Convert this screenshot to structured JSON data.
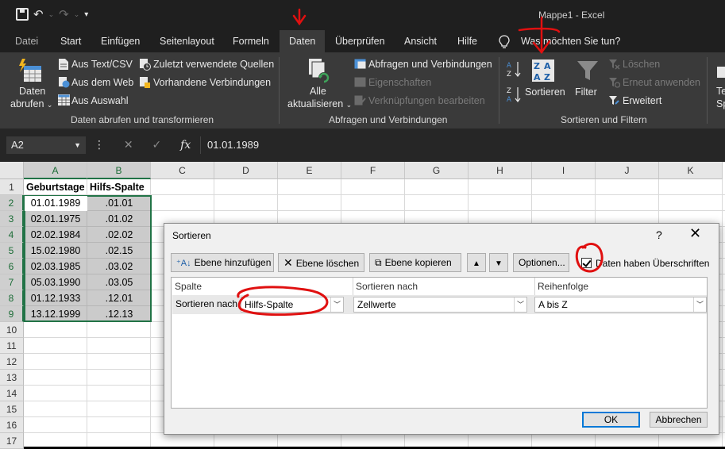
{
  "app": {
    "doc_title": "Mappe1  -  Excel"
  },
  "tabs": [
    {
      "label": "Datei"
    },
    {
      "label": "Start"
    },
    {
      "label": "Einfügen"
    },
    {
      "label": "Seitenlayout"
    },
    {
      "label": "Formeln"
    },
    {
      "label": "Daten"
    },
    {
      "label": "Überprüfen"
    },
    {
      "label": "Ansicht"
    },
    {
      "label": "Hilfe"
    }
  ],
  "tell_me": "Was möchten Sie tun?",
  "ribbon": {
    "get_data": {
      "line1": "Daten",
      "line2": "abrufen"
    },
    "from_text": "Aus Text/CSV",
    "from_web": "Aus dem Web",
    "from_table": "Aus Auswahl",
    "recent_sources": "Zuletzt verwendete Quellen",
    "existing_connections": "Vorhandene Verbindungen",
    "group1": "Daten abrufen und transformieren",
    "refresh_all": {
      "line1": "Alle",
      "line2": "aktualisieren"
    },
    "queries_connections": "Abfragen und Verbindungen",
    "properties": "Eigenschaften",
    "edit_links": "Verknüpfungen bearbeiten",
    "group2": "Abfragen und Verbindungen",
    "sort": "Sortieren",
    "filter": "Filter",
    "clear": "Löschen",
    "reapply": "Erneut anwenden",
    "advanced": "Erweitert",
    "group3": "Sortieren und Filtern",
    "text_to_cols": {
      "line1": "Te",
      "line2": "Sp"
    }
  },
  "formula_bar": {
    "name_box": "A2",
    "value": "01.01.1989"
  },
  "sheet": {
    "columns": [
      "A",
      "B",
      "C",
      "D",
      "E",
      "F",
      "G",
      "H",
      "I",
      "J",
      "K"
    ],
    "rows": [
      "1",
      "2",
      "3",
      "4",
      "5",
      "6",
      "7",
      "8",
      "9",
      "10",
      "11",
      "12",
      "13",
      "14",
      "15",
      "16",
      "17"
    ],
    "header": [
      "Geburtstage",
      "Hilfs-Spalte"
    ],
    "data": [
      [
        "01.01.1989",
        ".01.01"
      ],
      [
        "02.01.1975",
        ".01.02"
      ],
      [
        "02.02.1984",
        ".02.02"
      ],
      [
        "15.02.1980",
        ".02.15"
      ],
      [
        "02.03.1985",
        ".03.02"
      ],
      [
        "05.03.1990",
        ".03.05"
      ],
      [
        "01.12.1933",
        ".12.01"
      ],
      [
        "13.12.1999",
        ".12.13"
      ]
    ]
  },
  "dialog": {
    "title": "Sortieren",
    "help": "?",
    "close": "✕",
    "add_level": "Ebene hinzufügen",
    "delete_level": "Ebene löschen",
    "copy_level": "Ebene kopieren",
    "options": "Optionen...",
    "has_headers": "Daten haben Überschriften",
    "col_header": "Spalte",
    "sort_on_header": "Sortieren nach",
    "order_header": "Reihenfolge",
    "row_label": "Sortieren nach",
    "column_value": "Hilfs-Spalte",
    "sort_on_value": "Zellwerte",
    "order_value": "A bis Z",
    "ok": "OK",
    "cancel": "Abbrechen"
  },
  "colors": {
    "ribbon_bg": "#3a3a3a",
    "title_bg": "#1f1f1f",
    "excel_green": "#217346",
    "annotation_red": "#e01010",
    "dialog_bg": "#f0f0f0"
  }
}
